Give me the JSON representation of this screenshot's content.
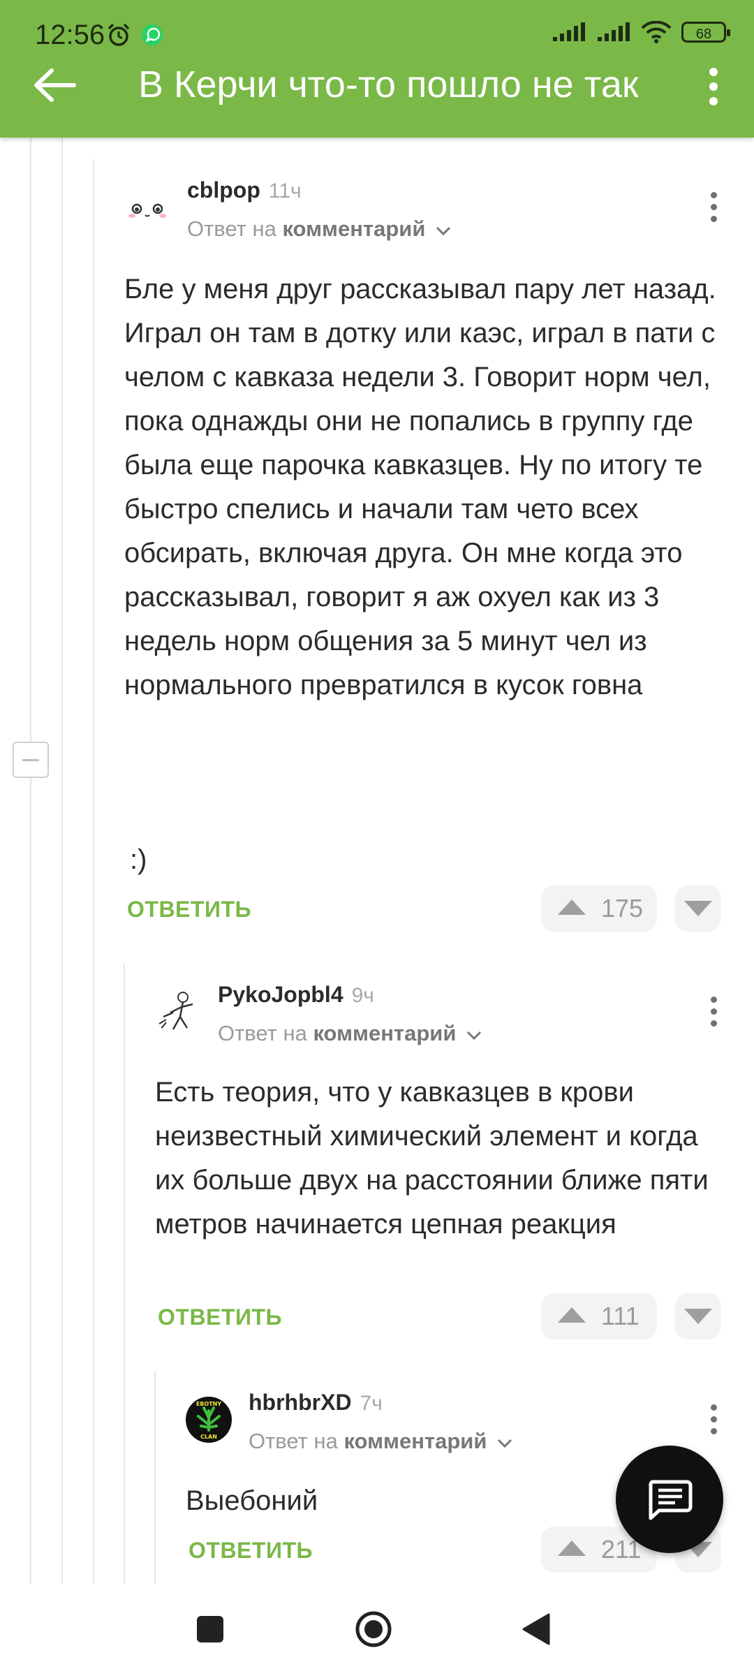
{
  "status_bar": {
    "time": "12:56",
    "battery": "68",
    "icons": [
      "alarm-icon",
      "whatsapp-icon",
      "signal-icon",
      "signal-icon",
      "wifi-icon",
      "battery-icon"
    ]
  },
  "appbar": {
    "title": "В Керчи что-то пошло не так",
    "back_icon": "arrow-left-icon",
    "menu_icon": "more-vertical-icon",
    "color": "#7ab847"
  },
  "comments": [
    {
      "author": "cblpop",
      "time": "11ч",
      "reply_prefix": "Ответ на",
      "reply_target": "комментарий",
      "text": "Бле у меня друг рассказывал пару лет назад. Играл он там в дотку или каэс, играл в пати с челом с кавказа недели 3. Говорит норм чел, пока однажды они не попались в группу где была еще парочка кавказцев. Ну по итогу те быстро спелись и начали там чето всех обсирать, включая друга. Он мне когда это рассказывал, говорит я аж охуел как из 3 недель норм общения за 5 минут чел из нормального превратился в кусок говна",
      "extra": ":)",
      "reply_label": "ОТВЕТИТЬ",
      "rating": "175"
    },
    {
      "author": "PykoJopbl4",
      "time": "9ч",
      "reply_prefix": "Ответ на",
      "reply_target": "комментарий",
      "text": "Есть теория, что у кавказцев в крови неизвестный химический элемент и когда их больше двух на расстоянии ближе пяти метров начинается цепная реакция",
      "reply_label": "ОТВЕТИТЬ",
      "rating": "111"
    },
    {
      "author": "hbrhbrXD",
      "time": "7ч",
      "reply_prefix": "Ответ на",
      "reply_target": "комментарий",
      "text": "Выебоний",
      "reply_label": "ОТВЕТИТЬ",
      "rating": "211"
    }
  ],
  "avatar3_text": {
    "top": "EBOTNY",
    "bottom": "CLAN"
  },
  "fab": {
    "icon": "comment-icon"
  },
  "nav": {
    "icons": [
      "recent-apps-icon",
      "home-icon",
      "back-icon"
    ]
  }
}
